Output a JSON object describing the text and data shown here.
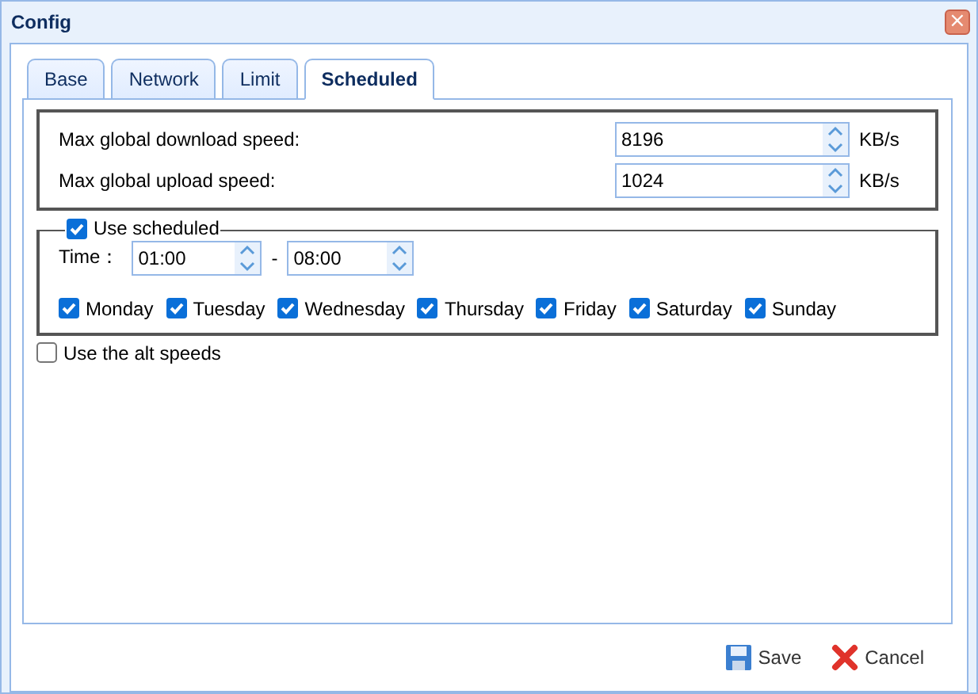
{
  "window": {
    "title": "Config",
    "close": "×"
  },
  "tabs": [
    {
      "label": "Base",
      "selected": false
    },
    {
      "label": "Network",
      "selected": false
    },
    {
      "label": "Limit",
      "selected": false
    },
    {
      "label": "Scheduled",
      "selected": true
    }
  ],
  "speeds": [
    {
      "label": "Max global download speed:",
      "value": "8196",
      "unit": "KB/s"
    },
    {
      "label": "Max global upload speed:",
      "value": "1024",
      "unit": "KB/s"
    }
  ],
  "scheduled": {
    "label": "Use scheduled",
    "checked": true,
    "time_label": "Time：",
    "start": "01:00",
    "separator": "-",
    "end": "08:00",
    "days": [
      {
        "label": "Monday",
        "checked": true
      },
      {
        "label": "Tuesday",
        "checked": true
      },
      {
        "label": "Wednesday",
        "checked": true
      },
      {
        "label": "Thursday",
        "checked": true
      },
      {
        "label": "Friday",
        "checked": true
      },
      {
        "label": "Saturday",
        "checked": true
      },
      {
        "label": "Sunday",
        "checked": true
      }
    ]
  },
  "alt_speeds": {
    "label": "Use the alt speeds",
    "checked": false
  },
  "buttons": [
    {
      "kind": "save",
      "label": "Save"
    },
    {
      "kind": "cancel",
      "label": "Cancel"
    }
  ]
}
